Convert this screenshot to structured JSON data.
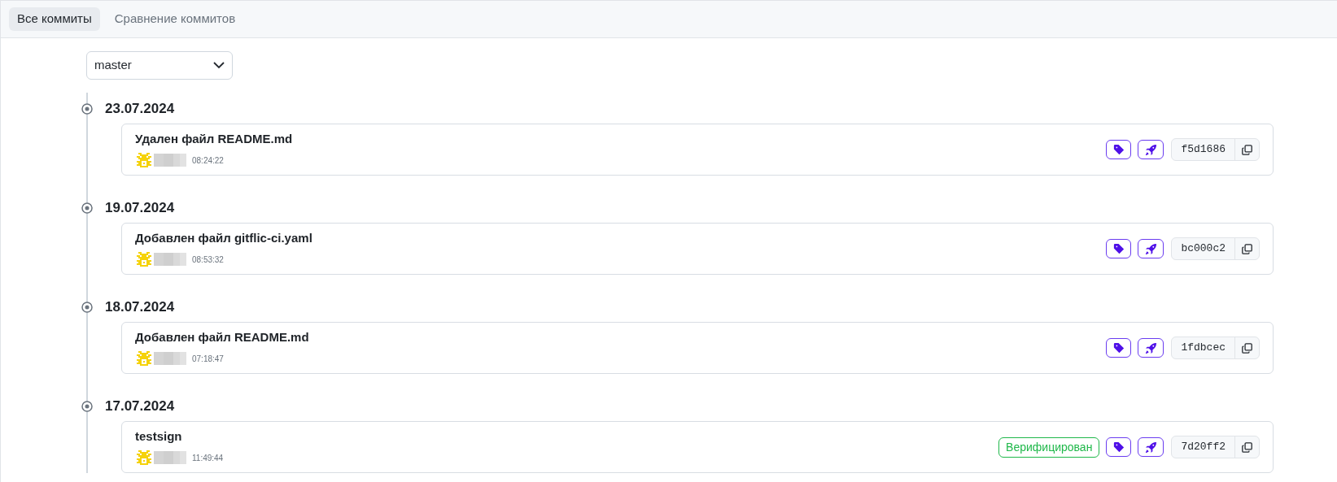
{
  "tabs": [
    {
      "label": "Все коммиты",
      "selected": true
    },
    {
      "label": "Сравнение коммитов",
      "selected": false
    }
  ],
  "branch_select": {
    "value": "master"
  },
  "commit_groups": [
    {
      "date": "23.07.2024",
      "commits": [
        {
          "message": "Удален файл README.md",
          "time": "08:24:22",
          "verified": false,
          "hash": "f5d1686"
        }
      ]
    },
    {
      "date": "19.07.2024",
      "commits": [
        {
          "message": "Добавлен файл gitflic-ci.yaml",
          "time": "08:53:32",
          "verified": false,
          "hash": "bc000c2"
        }
      ]
    },
    {
      "date": "18.07.2024",
      "commits": [
        {
          "message": "Добавлен файл README.md",
          "time": "07:18:47",
          "verified": false,
          "hash": "1fdbcec"
        }
      ]
    },
    {
      "date": "17.07.2024",
      "commits": [
        {
          "message": "testsign",
          "time": "11:49:44",
          "verified": true,
          "verified_label": "Верифицирован",
          "hash": "7d20ff2"
        }
      ]
    }
  ]
}
